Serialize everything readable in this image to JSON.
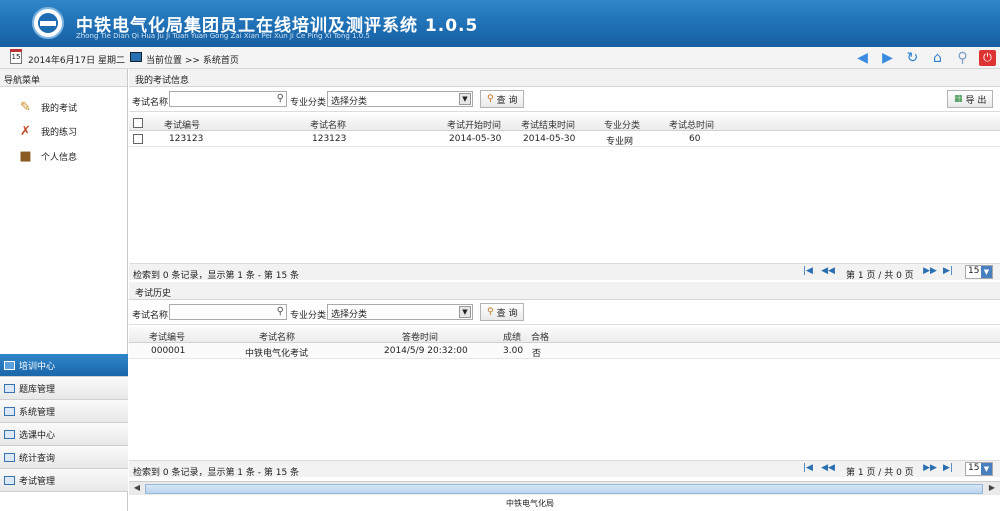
{
  "header": {
    "title": "中铁电气化局集团员工在线培训及测评系统 1.0.5",
    "subtitle": "Zhong Tie Dian Qi Hua Ju Ji Tuan Yuan Gong Zai Xian Pei Xun Ji Ce Ping Xi Tong 1.0.5",
    "logo_icon": "railway-logo"
  },
  "topbar": {
    "calendar_day": "15",
    "date": "2014年6月17日 星期二",
    "location_label": "当前位置",
    "location_path": ">> 系统首页",
    "icons": [
      "arrow-left-icon",
      "arrow-right-icon",
      "refresh-icon",
      "home-icon",
      "search-icon",
      "power-icon"
    ]
  },
  "sidebar": {
    "title": "导航菜单",
    "items": [
      {
        "label": "我的考试",
        "icon": "edit-icon"
      },
      {
        "label": "我的练习",
        "icon": "tools-icon"
      },
      {
        "label": "个人信息",
        "icon": "briefcase-icon"
      }
    ],
    "modules": [
      {
        "label": "培训中心",
        "active": true
      },
      {
        "label": "题库管理",
        "active": false
      },
      {
        "label": "系统管理",
        "active": false
      },
      {
        "label": "选课中心",
        "active": false
      },
      {
        "label": "统计查询",
        "active": false
      },
      {
        "label": "考试管理",
        "active": false
      }
    ]
  },
  "exam_info": {
    "title": "我的考试信息",
    "search_name_label": "考试名称",
    "search_name_value": "",
    "category_label": "专业分类",
    "category_value": "选择分类",
    "query_button": "查 询",
    "export_button": "导 出",
    "columns": [
      "考试编号",
      "考试名称",
      "考试开始时间",
      "考试结束时间",
      "专业分类",
      "考试总时间"
    ],
    "rows": [
      {
        "id": "123123",
        "name": "123123",
        "start": "2014-05-30",
        "end": "2014-05-30",
        "category": "专业网",
        "duration": "60"
      }
    ],
    "pager": {
      "info": "检索到 0 条记录，显示第 1 条 - 第 15 条",
      "page_text": "第 1 页 / 共 0 页",
      "page_size": "15"
    }
  },
  "exam_history": {
    "title": "考试历史",
    "search_name_label": "考试名称",
    "search_name_value": "",
    "category_label": "专业分类",
    "category_value": "选择分类",
    "query_button": "查 询",
    "columns": [
      "考试编号",
      "考试名称",
      "答卷时间",
      "成绩",
      "合格"
    ],
    "rows": [
      {
        "id": "000001",
        "name": "中铁电气化考试",
        "time": "2014/5/9 20:32:00",
        "score": "3.00",
        "pass": "否"
      }
    ],
    "pager": {
      "info": "检索到 0 条记录，显示第 1 条 - 第 15 条",
      "page_text": "第 1 页 / 共 0 页",
      "page_size": "15"
    }
  },
  "footer": {
    "text": "中铁电气化局"
  },
  "colors": {
    "header_blue": "#1e6db2",
    "active_module": "#2f86c9"
  }
}
